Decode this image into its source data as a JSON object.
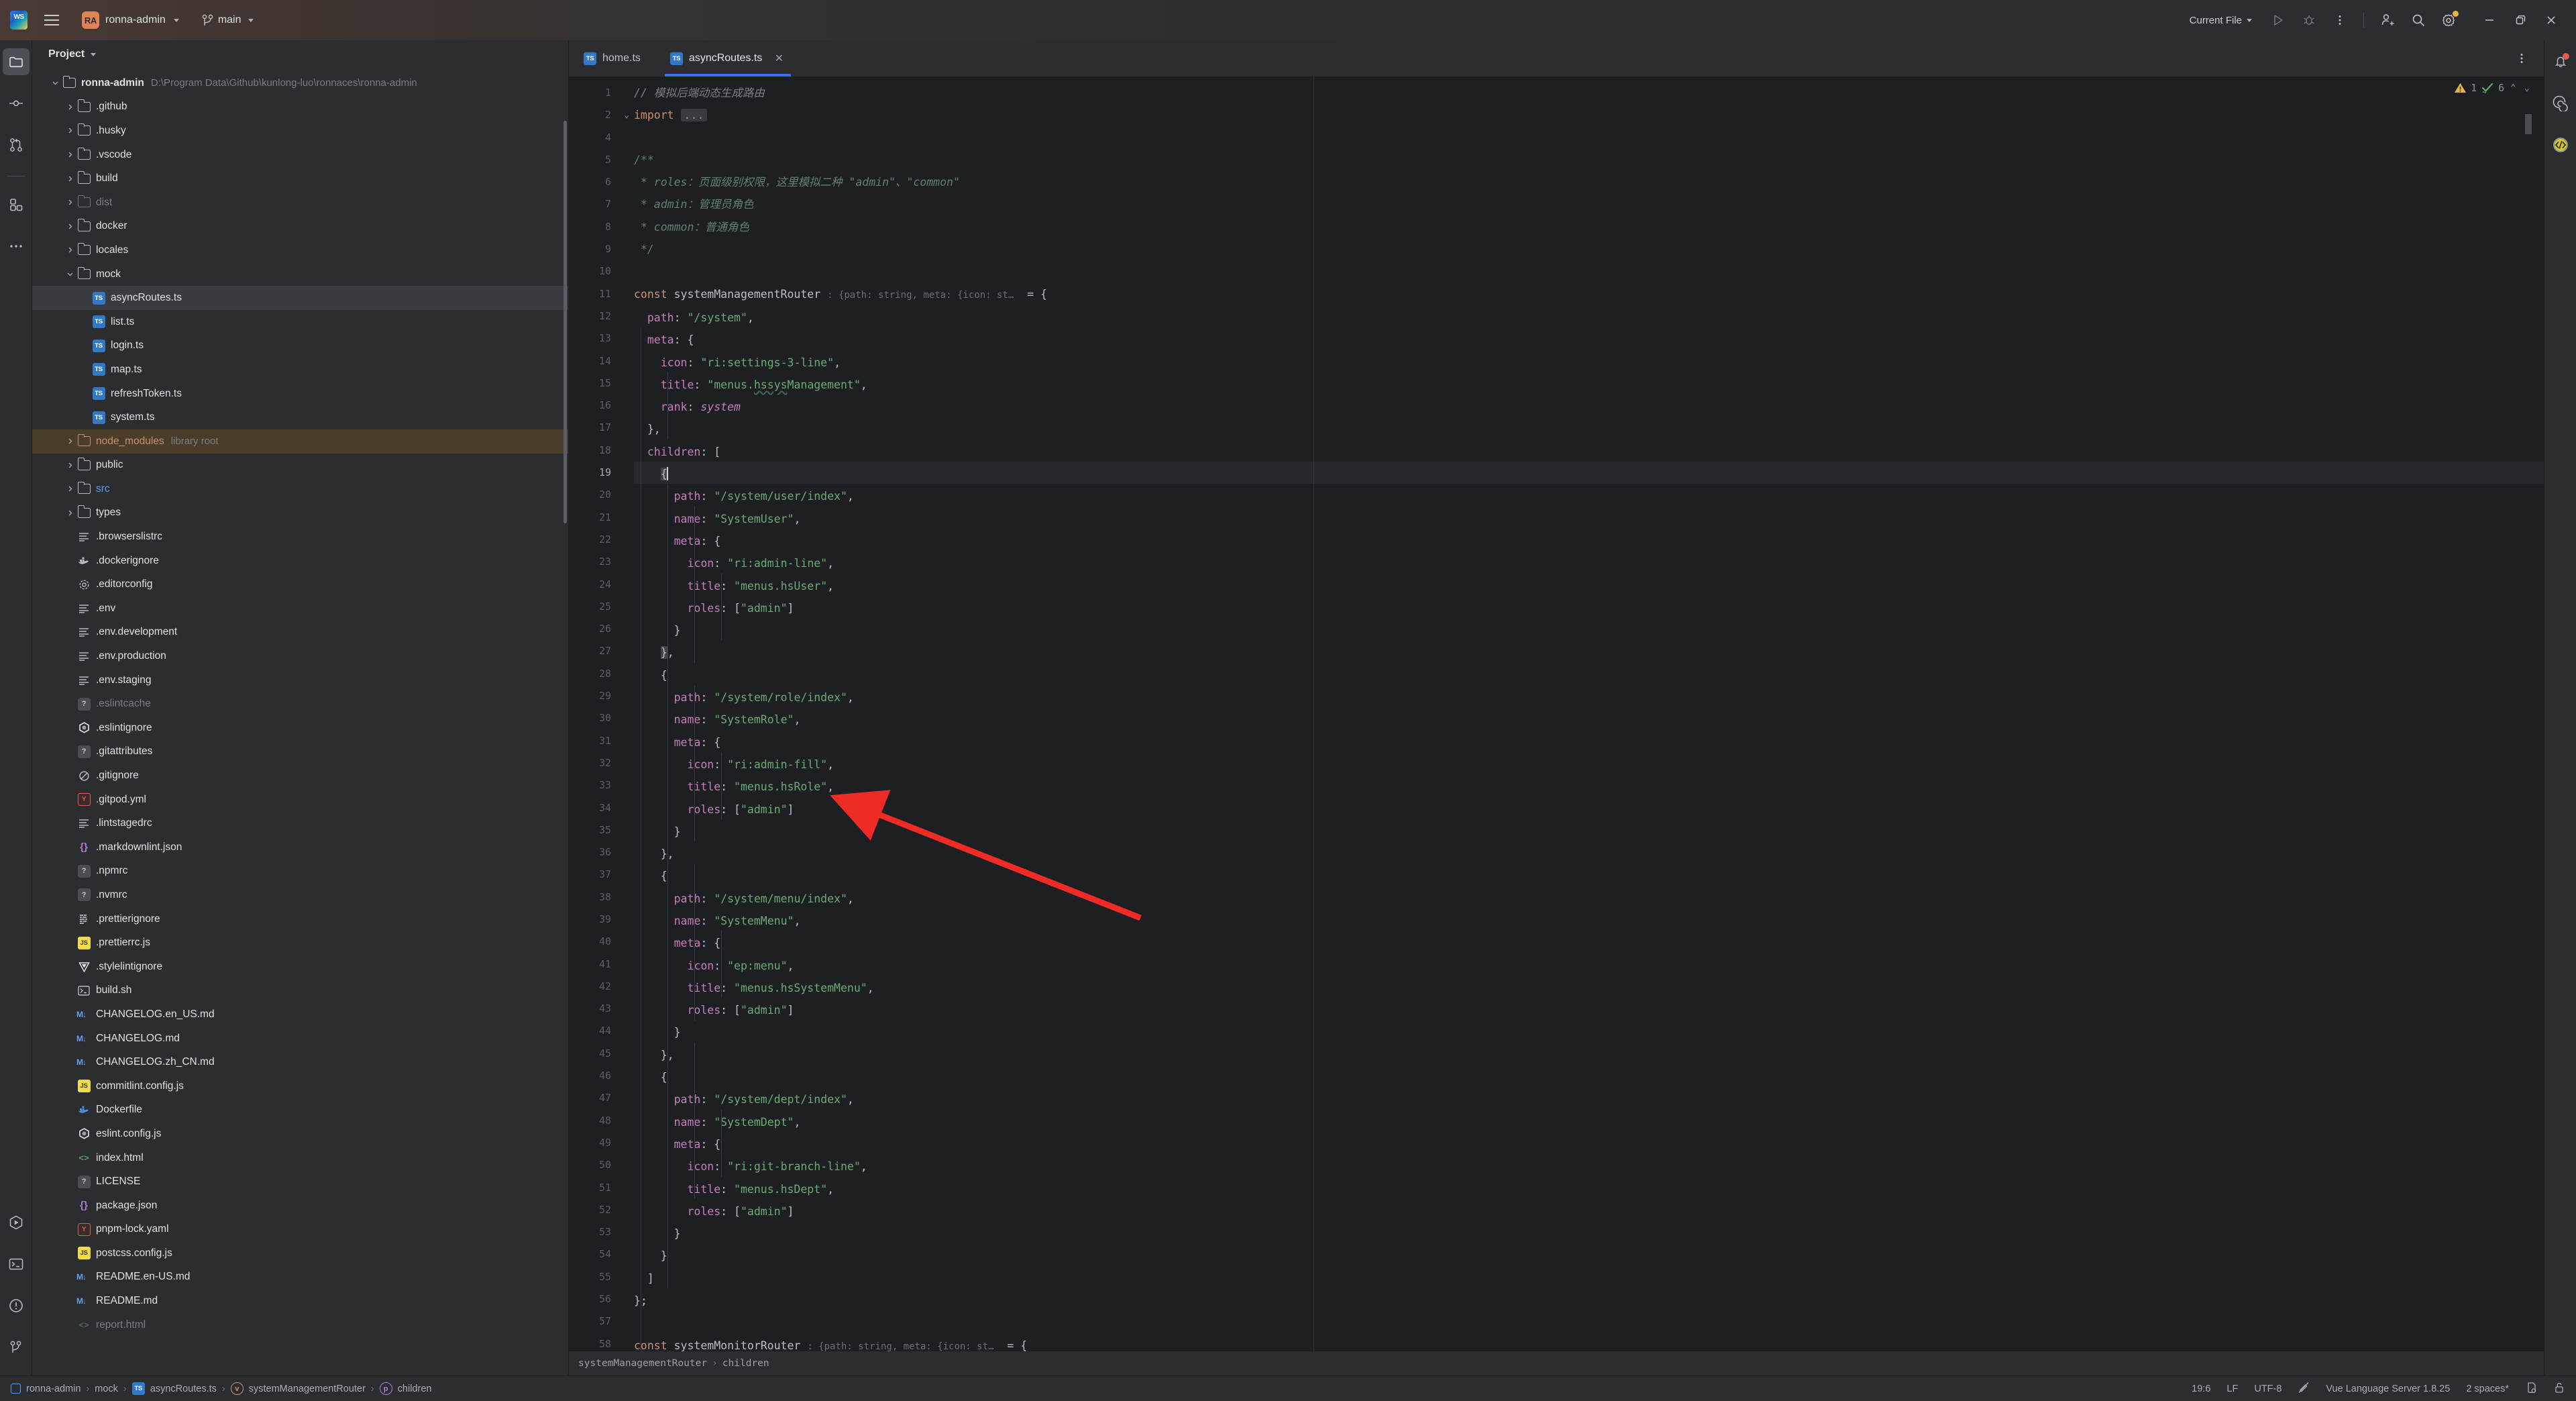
{
  "titlebar": {
    "ide_logo": "webstorm-logo",
    "menu_icon": "hamburger-menu-icon",
    "project_badge": "RA",
    "project_name": "ronna-admin",
    "branch_icon": "git-branch-icon",
    "branch_name": "main",
    "run_config": "Current File",
    "run_icon": "run-icon",
    "debug_icon": "debug-icon",
    "more_icon": "more-vertical-icon",
    "share_icon": "add-user-icon",
    "search_icon": "search-icon",
    "settings_icon": "gear-icon",
    "minimize": "minimize-icon",
    "maximize": "maximize-icon",
    "close": "close-icon"
  },
  "left_stripe": [
    {
      "name": "project",
      "icon": "folder-icon",
      "active": true
    },
    {
      "name": "commit",
      "icon": "commit-icon",
      "active": false
    },
    {
      "name": "pull-requests",
      "icon": "pull-request-icon",
      "active": false
    },
    {
      "name": "plugins",
      "icon": "squares-icon",
      "active": false
    },
    {
      "name": "more-tool-windows",
      "icon": "more-horizontal-icon",
      "active": false
    }
  ],
  "left_stripe_bottom": [
    {
      "name": "run",
      "icon": "run-hex-icon"
    },
    {
      "name": "terminal",
      "icon": "terminal-icon"
    },
    {
      "name": "problems",
      "icon": "exclamation-circle-icon"
    },
    {
      "name": "version-control",
      "icon": "git-branch-icon"
    }
  ],
  "right_stripe": [
    {
      "name": "notifications",
      "icon": "bell-icon",
      "badge": true
    },
    {
      "name": "ai-assistant",
      "icon": "spiral-icon",
      "badge": false
    },
    {
      "name": "code-with-me",
      "icon": "code-circle-icon",
      "badge": false
    }
  ],
  "project_panel": {
    "title": "Project",
    "chevron": "chevron-down-icon",
    "tree": [
      {
        "depth": 0,
        "label": "ronna-admin",
        "note": "D:\\Program Data\\Github\\kunlong-luo\\ronnaces\\ronna-admin",
        "icon": "folder",
        "arrow": "down",
        "bold": true
      },
      {
        "depth": 1,
        "label": ".github",
        "icon": "folder",
        "arrow": "right"
      },
      {
        "depth": 1,
        "label": ".husky",
        "icon": "folder",
        "arrow": "right"
      },
      {
        "depth": 1,
        "label": ".vscode",
        "icon": "folder",
        "arrow": "right"
      },
      {
        "depth": 1,
        "label": "build",
        "icon": "folder",
        "arrow": "right"
      },
      {
        "depth": 1,
        "label": "dist",
        "icon": "folder",
        "arrow": "right",
        "dim": true
      },
      {
        "depth": 1,
        "label": "docker",
        "icon": "folder",
        "arrow": "right"
      },
      {
        "depth": 1,
        "label": "locales",
        "icon": "folder",
        "arrow": "right"
      },
      {
        "depth": 1,
        "label": "mock",
        "icon": "folder",
        "arrow": "down"
      },
      {
        "depth": 2,
        "label": "asyncRoutes.ts",
        "icon": "ts",
        "selected": true
      },
      {
        "depth": 2,
        "label": "list.ts",
        "icon": "ts"
      },
      {
        "depth": 2,
        "label": "login.ts",
        "icon": "ts"
      },
      {
        "depth": 2,
        "label": "map.ts",
        "icon": "ts"
      },
      {
        "depth": 2,
        "label": "refreshToken.ts",
        "icon": "ts"
      },
      {
        "depth": 2,
        "label": "system.ts",
        "icon": "ts"
      },
      {
        "depth": 1,
        "label": "node_modules",
        "note": "library root",
        "icon": "folder-orange",
        "arrow": "right",
        "orange": true,
        "lib": true
      },
      {
        "depth": 1,
        "label": "public",
        "icon": "folder",
        "arrow": "right"
      },
      {
        "depth": 1,
        "label": "src",
        "icon": "folder",
        "arrow": "right",
        "blue": true
      },
      {
        "depth": 1,
        "label": "types",
        "icon": "folder",
        "arrow": "right"
      },
      {
        "depth": 1,
        "label": ".browserslistrc",
        "icon": "lines"
      },
      {
        "depth": 1,
        "label": ".dockerignore",
        "icon": "docker"
      },
      {
        "depth": 1,
        "label": ".editorconfig",
        "icon": "gear"
      },
      {
        "depth": 1,
        "label": ".env",
        "icon": "lines"
      },
      {
        "depth": 1,
        "label": ".env.development",
        "icon": "lines"
      },
      {
        "depth": 1,
        "label": ".env.production",
        "icon": "lines"
      },
      {
        "depth": 1,
        "label": ".env.staging",
        "icon": "lines"
      },
      {
        "depth": 1,
        "label": ".eslintcache",
        "icon": "question",
        "dim": true
      },
      {
        "depth": 1,
        "label": ".eslintignore",
        "icon": "eslint"
      },
      {
        "depth": 1,
        "label": ".gitattributes",
        "icon": "question"
      },
      {
        "depth": 1,
        "label": ".gitignore",
        "icon": "gitignore"
      },
      {
        "depth": 1,
        "label": ".gitpod.yml",
        "icon": "yaml"
      },
      {
        "depth": 1,
        "label": ".lintstagedrc",
        "icon": "lines"
      },
      {
        "depth": 1,
        "label": ".markdownlint.json",
        "icon": "json"
      },
      {
        "depth": 1,
        "label": ".npmrc",
        "icon": "question"
      },
      {
        "depth": 1,
        "label": ".nvmrc",
        "icon": "question"
      },
      {
        "depth": 1,
        "label": ".prettierignore",
        "icon": "prettier"
      },
      {
        "depth": 1,
        "label": ".prettierrc.js",
        "icon": "js"
      },
      {
        "depth": 1,
        "label": ".stylelintignore",
        "icon": "stylelint"
      },
      {
        "depth": 1,
        "label": "build.sh",
        "icon": "shell"
      },
      {
        "depth": 1,
        "label": "CHANGELOG.en_US.md",
        "icon": "md"
      },
      {
        "depth": 1,
        "label": "CHANGELOG.md",
        "icon": "md"
      },
      {
        "depth": 1,
        "label": "CHANGELOG.zh_CN.md",
        "icon": "md"
      },
      {
        "depth": 1,
        "label": "commitlint.config.js",
        "icon": "js"
      },
      {
        "depth": 1,
        "label": "Dockerfile",
        "icon": "docker-blue"
      },
      {
        "depth": 1,
        "label": "eslint.config.js",
        "icon": "eslint"
      },
      {
        "depth": 1,
        "label": "index.html",
        "icon": "html"
      },
      {
        "depth": 1,
        "label": "LICENSE",
        "icon": "question"
      },
      {
        "depth": 1,
        "label": "package.json",
        "icon": "json"
      },
      {
        "depth": 1,
        "label": "pnpm-lock.yaml",
        "icon": "yaml"
      },
      {
        "depth": 1,
        "label": "postcss.config.js",
        "icon": "js"
      },
      {
        "depth": 1,
        "label": "README.en-US.md",
        "icon": "md"
      },
      {
        "depth": 1,
        "label": "README.md",
        "icon": "md"
      },
      {
        "depth": 1,
        "label": "report.html",
        "icon": "html",
        "dim": true
      }
    ]
  },
  "editor": {
    "tabs": [
      {
        "label": "home.ts",
        "icon": "ts",
        "active": false,
        "closable": false
      },
      {
        "label": "asyncRoutes.ts",
        "icon": "ts",
        "active": true,
        "closable": true
      }
    ],
    "tab_more_icon": "more-vertical-icon",
    "inspections": {
      "warning_count": "1",
      "ok_count": "6",
      "warning_icon": "warning-triangle-icon",
      "ok_icon": "check-icon",
      "up_icon": "chevron-up-icon",
      "down_icon": "chevron-down-icon"
    },
    "type_hint": ": {path: string, meta: {icon: st…",
    "folded_marker": "...",
    "cursor_line": 19,
    "lines": [
      {
        "n": "1",
        "html": "<span class=\"cmt\">// 模拟后端动态生成路由</span>"
      },
      {
        "n": "2",
        "fold": "down",
        "html": "<span class=\"kw\">import</span> <span class=\"folded\">...</span>"
      },
      {
        "n": "4",
        "html": ""
      },
      {
        "n": "5",
        "html": "<span class=\"cmt-doc\">/**</span>"
      },
      {
        "n": "6",
        "html": "<span class=\"cmt-doc\"> * roles：页面级别权限，这里模拟二种 \"admin\"、\"common\"</span>"
      },
      {
        "n": "7",
        "html": "<span class=\"cmt-doc\"> * admin：管理员角色</span>"
      },
      {
        "n": "8",
        "html": "<span class=\"cmt-doc\"> * common：普通角色</span>"
      },
      {
        "n": "9",
        "html": "<span class=\"cmt-doc\"> */</span>"
      },
      {
        "n": "10",
        "html": ""
      },
      {
        "n": "11",
        "html": "<span class=\"kw\">const</span> <span class=\"ident\">systemManagementRouter</span> <span class=\"hint\">: {path: string, meta: {icon: st…</span>  <span class=\"punc\">= {</span>"
      },
      {
        "n": "12",
        "html": "  <span class=\"prop\">path</span><span class=\"punc\">:</span> <span class=\"str\">\"/system\"</span><span class=\"punc\">,</span>"
      },
      {
        "n": "13",
        "html": "  <span class=\"prop\">meta</span><span class=\"punc\">: {</span>"
      },
      {
        "n": "14",
        "html": "    <span class=\"prop\">icon</span><span class=\"punc\">:</span> <span class=\"str\">\"ri:settings-3-line\"</span><span class=\"punc\">,</span>"
      },
      {
        "n": "15",
        "html": "    <span class=\"prop\">title</span><span class=\"punc\">:</span> <span class=\"str\">\"menus.<span class=\"squig\">hssys</span>Management\"</span><span class=\"punc\">,</span>"
      },
      {
        "n": "16",
        "html": "    <span class=\"prop\">rank</span><span class=\"punc\">:</span> <span class=\"italic-v\">system</span>"
      },
      {
        "n": "17",
        "html": "  <span class=\"punc\">},</span>"
      },
      {
        "n": "18",
        "html": "  <span class=\"prop\">children</span><span class=\"punc\">: [</span>"
      },
      {
        "n": "19",
        "cur": true,
        "html": "    <span class=\"sel-box\">{</span><span class=\"cursor-bar\"></span>"
      },
      {
        "n": "20",
        "html": "      <span class=\"prop\">path</span><span class=\"punc\">:</span> <span class=\"str\">\"/system/user/index\"</span><span class=\"punc\">,</span>"
      },
      {
        "n": "21",
        "html": "      <span class=\"prop\">name</span><span class=\"punc\">:</span> <span class=\"str\">\"SystemUser\"</span><span class=\"punc\">,</span>"
      },
      {
        "n": "22",
        "html": "      <span class=\"prop\">meta</span><span class=\"punc\">: {</span>"
      },
      {
        "n": "23",
        "html": "        <span class=\"prop\">icon</span><span class=\"punc\">:</span> <span class=\"str\">\"ri:admin-line\"</span><span class=\"punc\">,</span>"
      },
      {
        "n": "24",
        "html": "        <span class=\"prop\">title</span><span class=\"punc\">:</span> <span class=\"str\">\"menus.hsUser\"</span><span class=\"punc\">,</span>"
      },
      {
        "n": "25",
        "html": "        <span class=\"prop\">roles</span><span class=\"punc\">:</span> <span class=\"punc\">[</span><span class=\"str\">\"admin\"</span><span class=\"punc\">]</span>"
      },
      {
        "n": "26",
        "html": "      <span class=\"punc\">}</span>"
      },
      {
        "n": "27",
        "html": "    <span class=\"sel-box\">}</span><span class=\"punc\">,</span>"
      },
      {
        "n": "28",
        "html": "    <span class=\"punc\">{</span>"
      },
      {
        "n": "29",
        "html": "      <span class=\"prop\">path</span><span class=\"punc\">:</span> <span class=\"str\">\"/system/role/index\"</span><span class=\"punc\">,</span>"
      },
      {
        "n": "30",
        "html": "      <span class=\"prop\">name</span><span class=\"punc\">:</span> <span class=\"str\">\"SystemRole\"</span><span class=\"punc\">,</span>"
      },
      {
        "n": "31",
        "html": "      <span class=\"prop\">meta</span><span class=\"punc\">: {</span>"
      },
      {
        "n": "32",
        "html": "        <span class=\"prop\">icon</span><span class=\"punc\">:</span> <span class=\"str\">\"ri:admin-fill\"</span><span class=\"punc\">,</span>"
      },
      {
        "n": "33",
        "html": "        <span class=\"prop\">title</span><span class=\"punc\">:</span> <span class=\"str\">\"menus.hsRole\"</span><span class=\"punc\">,</span>"
      },
      {
        "n": "34",
        "html": "        <span class=\"prop\">roles</span><span class=\"punc\">:</span> <span class=\"punc\">[</span><span class=\"str\">\"admin\"</span><span class=\"punc\">]</span>"
      },
      {
        "n": "35",
        "html": "      <span class=\"punc\">}</span>"
      },
      {
        "n": "36",
        "html": "    <span class=\"punc\">},</span>"
      },
      {
        "n": "37",
        "html": "    <span class=\"punc\">{</span>"
      },
      {
        "n": "38",
        "html": "      <span class=\"prop\">path</span><span class=\"punc\">:</span> <span class=\"str\">\"/system/menu/index\"</span><span class=\"punc\">,</span>"
      },
      {
        "n": "39",
        "html": "      <span class=\"prop\">name</span><span class=\"punc\">:</span> <span class=\"str\">\"SystemMenu\"</span><span class=\"punc\">,</span>"
      },
      {
        "n": "40",
        "html": "      <span class=\"prop\">meta</span><span class=\"punc\">: {</span>"
      },
      {
        "n": "41",
        "html": "        <span class=\"prop\">icon</span><span class=\"punc\">:</span> <span class=\"str\">\"ep:menu\"</span><span class=\"punc\">,</span>"
      },
      {
        "n": "42",
        "html": "        <span class=\"prop\">title</span><span class=\"punc\">:</span> <span class=\"str\">\"menus.hsSystemMenu\"</span><span class=\"punc\">,</span>"
      },
      {
        "n": "43",
        "html": "        <span class=\"prop\">roles</span><span class=\"punc\">:</span> <span class=\"punc\">[</span><span class=\"str\">\"admin\"</span><span class=\"punc\">]</span>"
      },
      {
        "n": "44",
        "html": "      <span class=\"punc\">}</span>"
      },
      {
        "n": "45",
        "html": "    <span class=\"punc\">},</span>"
      },
      {
        "n": "46",
        "html": "    <span class=\"punc\">{</span>"
      },
      {
        "n": "47",
        "html": "      <span class=\"prop\">path</span><span class=\"punc\">:</span> <span class=\"str\">\"/system/dept/index\"</span><span class=\"punc\">,</span>"
      },
      {
        "n": "48",
        "html": "      <span class=\"prop\">name</span><span class=\"punc\">:</span> <span class=\"str\">\"SystemDept\"</span><span class=\"punc\">,</span>"
      },
      {
        "n": "49",
        "html": "      <span class=\"prop\">meta</span><span class=\"punc\">: {</span>"
      },
      {
        "n": "50",
        "html": "        <span class=\"prop\">icon</span><span class=\"punc\">:</span> <span class=\"str\">\"ri:git-branch-line\"</span><span class=\"punc\">,</span>"
      },
      {
        "n": "51",
        "html": "        <span class=\"prop\">title</span><span class=\"punc\">:</span> <span class=\"str\">\"menus.hsDept\"</span><span class=\"punc\">,</span>"
      },
      {
        "n": "52",
        "html": "        <span class=\"prop\">roles</span><span class=\"punc\">:</span> <span class=\"punc\">[</span><span class=\"str\">\"admin\"</span><span class=\"punc\">]</span>"
      },
      {
        "n": "53",
        "html": "      <span class=\"punc\">}</span>"
      },
      {
        "n": "54",
        "html": "    <span class=\"punc\">}</span>"
      },
      {
        "n": "55",
        "html": "  <span class=\"punc\">]</span>"
      },
      {
        "n": "56",
        "html": "<span class=\"punc\">};</span>"
      },
      {
        "n": "57",
        "html": ""
      },
      {
        "n": "58",
        "html": "<span class=\"kw\">const</span> <span class=\"ident\">systemMonitorRouter</span> <span class=\"hint\">: {path: string, meta: {icon: st…</span>  <span class=\"punc\">= {</span>"
      }
    ],
    "breadcrumb": [
      "systemManagementRouter",
      "children"
    ]
  },
  "statusbar": {
    "crumbs": [
      {
        "label": "ronna-admin",
        "icon": "project-icon"
      },
      {
        "label": "mock",
        "icon": null
      },
      {
        "label": "asyncRoutes.ts",
        "icon": "ts"
      },
      {
        "label": "systemManagementRouter",
        "icon": "variable-icon"
      },
      {
        "label": "children",
        "icon": "property-icon"
      }
    ],
    "caret_position": "19:6",
    "line_separator": "LF",
    "encoding": "UTF-8",
    "read_only_icon": "no-edit-icon",
    "language_server": "Vue Language Server 1.8.25",
    "indent": "2 spaces*",
    "indent_icon": "indent-config-icon",
    "lock_icon": "unlock-icon"
  },
  "annotation": {
    "type": "red-arrow",
    "points_at": "line 34 roles: [\"admin\"]",
    "color": "#ee2b25"
  }
}
